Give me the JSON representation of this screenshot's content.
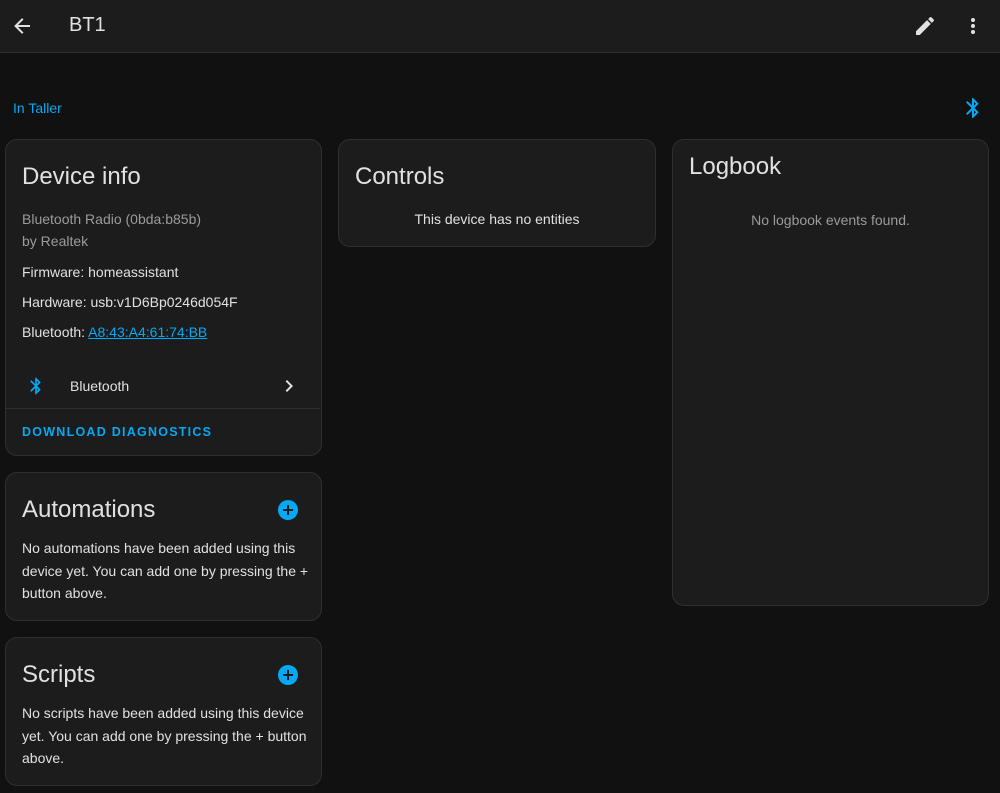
{
  "header": {
    "title": "BT1",
    "back_icon": "arrow-left-icon",
    "edit_icon": "pencil-icon",
    "menu_icon": "dots-vertical-icon"
  },
  "area": {
    "link_text": "In Taller",
    "integration_icon": "bluetooth-icon"
  },
  "device_info": {
    "title": "Device info",
    "model": "Bluetooth Radio (0bda:b85b)",
    "manufacturer": "by Realtek",
    "firmware_label": "Firmware: ",
    "firmware_value": "homeassistant",
    "hardware_label": "Hardware: ",
    "hardware_value": "usb:v1D6Bp0246d054F",
    "bluetooth_label": "Bluetooth: ",
    "bluetooth_value": "A8:43:A4:61:74:BB",
    "integration_label": "Bluetooth",
    "download_button": "Download diagnostics"
  },
  "automations": {
    "title": "Automations",
    "text": "No automations have been added using this device yet. You can add one by pressing the + button above."
  },
  "scripts": {
    "title": "Scripts",
    "text": "No scripts have been added using this device yet. You can add one by pressing the + button above."
  },
  "controls": {
    "title": "Controls",
    "empty_text": "This device has no entities"
  },
  "logbook": {
    "title": "Logbook",
    "empty_text": "No logbook events found."
  },
  "colors": {
    "accent": "#03a9f4",
    "background": "#111111",
    "card": "#1c1c1c",
    "text": "#e1e1e1",
    "muted": "#9b9b9b"
  }
}
